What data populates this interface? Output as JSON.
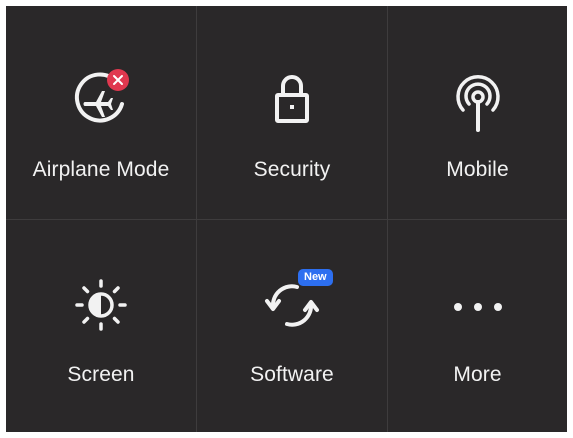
{
  "tiles": {
    "airplane": {
      "label": "Airplane Mode",
      "icon": "airplane-mode-icon",
      "status_icon": "error-x-badge-icon"
    },
    "security": {
      "label": "Security",
      "icon": "lock-icon"
    },
    "mobile": {
      "label": "Mobile",
      "icon": "antenna-signal-icon"
    },
    "screen": {
      "label": "Screen",
      "icon": "brightness-icon"
    },
    "software": {
      "label": "Software",
      "icon": "update-sync-icon",
      "badge": "New"
    },
    "more": {
      "label": "More",
      "icon": "more-dots-icon"
    }
  },
  "colors": {
    "panel_bg": "#2a2829",
    "divider": "#3e3c3d",
    "text": "#f2f2f2",
    "error_badge": "#e0384f",
    "new_badge": "#2d6ff0"
  }
}
